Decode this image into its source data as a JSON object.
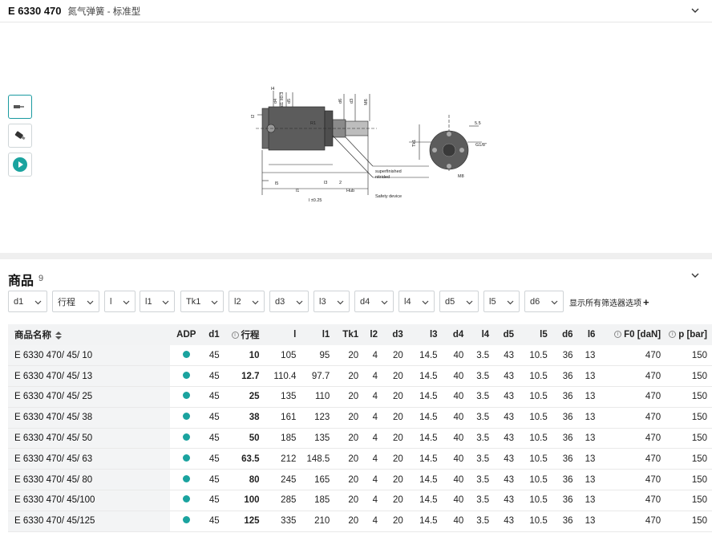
{
  "header": {
    "product_id": "E 6330 470",
    "product_name": "氮气弹簧 - 标准型"
  },
  "thumbnails": [
    {
      "name": "drawing-thumbnail",
      "active": true
    },
    {
      "name": "photo-thumbnail",
      "active": false
    },
    {
      "name": "video-thumbnail",
      "active": false
    }
  ],
  "drawing": {
    "labels": {
      "l2": "l2",
      "l4": "l4",
      "d4": "d4",
      "d1": "d1 ±0.3",
      "d5": "d5",
      "r1": "R1",
      "d6": "d6",
      "d3": "d3",
      "m6": "M6",
      "tk1": "Tk1",
      "l5": "l5",
      "l1": "l1",
      "l3": "l3",
      "two": "2",
      "hub": "Hub",
      "l": "l ±0.25",
      "superfinished": "superfinished",
      "nitrided": "nitrided",
      "safety": "Safety device",
      "dim55": "5.5",
      "g18": "G1/8\"",
      "m8": "M8"
    }
  },
  "products": {
    "title": "商品",
    "count": "9"
  },
  "filters": [
    "d1",
    "行程",
    "l",
    "l1",
    "Tk1",
    "l2",
    "d3",
    "l3",
    "d4",
    "l4",
    "d5",
    "l5",
    "d6"
  ],
  "show_all_label": "显示所有筛选器选项",
  "table": {
    "headers": {
      "name": "商品名称",
      "adp": "ADP",
      "d1": "d1",
      "stroke": "行程",
      "l": "l",
      "l1": "l1",
      "tk1": "Tk1",
      "l2": "l2",
      "d3": "d3",
      "l3": "l3",
      "d4": "d4",
      "l4": "l4",
      "d5": "d5",
      "l5": "l5",
      "d6": "d6",
      "l6": "l6",
      "f0": "F0 [daN]",
      "p": "p [bar]"
    },
    "rows": [
      {
        "name": "E 6330 470/ 45/ 10",
        "d1": "45",
        "stroke": "10",
        "l": "105",
        "l1": "95",
        "tk1": "20",
        "l2": "4",
        "d3": "20",
        "l3": "14.5",
        "d4": "40",
        "l4": "3.5",
        "d5": "43",
        "l5": "10.5",
        "d6": "36",
        "l6": "13",
        "f0": "470",
        "p": "150"
      },
      {
        "name": "E 6330 470/ 45/ 13",
        "d1": "45",
        "stroke": "12.7",
        "l": "110.4",
        "l1": "97.7",
        "tk1": "20",
        "l2": "4",
        "d3": "20",
        "l3": "14.5",
        "d4": "40",
        "l4": "3.5",
        "d5": "43",
        "l5": "10.5",
        "d6": "36",
        "l6": "13",
        "f0": "470",
        "p": "150"
      },
      {
        "name": "E 6330 470/ 45/ 25",
        "d1": "45",
        "stroke": "25",
        "l": "135",
        "l1": "110",
        "tk1": "20",
        "l2": "4",
        "d3": "20",
        "l3": "14.5",
        "d4": "40",
        "l4": "3.5",
        "d5": "43",
        "l5": "10.5",
        "d6": "36",
        "l6": "13",
        "f0": "470",
        "p": "150"
      },
      {
        "name": "E 6330 470/ 45/ 38",
        "d1": "45",
        "stroke": "38",
        "l": "161",
        "l1": "123",
        "tk1": "20",
        "l2": "4",
        "d3": "20",
        "l3": "14.5",
        "d4": "40",
        "l4": "3.5",
        "d5": "43",
        "l5": "10.5",
        "d6": "36",
        "l6": "13",
        "f0": "470",
        "p": "150"
      },
      {
        "name": "E 6330 470/ 45/ 50",
        "d1": "45",
        "stroke": "50",
        "l": "185",
        "l1": "135",
        "tk1": "20",
        "l2": "4",
        "d3": "20",
        "l3": "14.5",
        "d4": "40",
        "l4": "3.5",
        "d5": "43",
        "l5": "10.5",
        "d6": "36",
        "l6": "13",
        "f0": "470",
        "p": "150"
      },
      {
        "name": "E 6330 470/ 45/ 63",
        "d1": "45",
        "stroke": "63.5",
        "l": "212",
        "l1": "148.5",
        "tk1": "20",
        "l2": "4",
        "d3": "20",
        "l3": "14.5",
        "d4": "40",
        "l4": "3.5",
        "d5": "43",
        "l5": "10.5",
        "d6": "36",
        "l6": "13",
        "f0": "470",
        "p": "150"
      },
      {
        "name": "E 6330 470/ 45/ 80",
        "d1": "45",
        "stroke": "80",
        "l": "245",
        "l1": "165",
        "tk1": "20",
        "l2": "4",
        "d3": "20",
        "l3": "14.5",
        "d4": "40",
        "l4": "3.5",
        "d5": "43",
        "l5": "10.5",
        "d6": "36",
        "l6": "13",
        "f0": "470",
        "p": "150"
      },
      {
        "name": "E 6330 470/ 45/100",
        "d1": "45",
        "stroke": "100",
        "l": "285",
        "l1": "185",
        "tk1": "20",
        "l2": "4",
        "d3": "20",
        "l3": "14.5",
        "d4": "40",
        "l4": "3.5",
        "d5": "43",
        "l5": "10.5",
        "d6": "36",
        "l6": "13",
        "f0": "470",
        "p": "150"
      },
      {
        "name": "E 6330 470/ 45/125",
        "d1": "45",
        "stroke": "125",
        "l": "335",
        "l1": "210",
        "tk1": "20",
        "l2": "4",
        "d3": "20",
        "l3": "14.5",
        "d4": "40",
        "l4": "3.5",
        "d5": "43",
        "l5": "10.5",
        "d6": "36",
        "l6": "13",
        "f0": "470",
        "p": "150"
      }
    ]
  },
  "colors": {
    "accent": "#1aa39f",
    "header_bg": "#f2f3f4",
    "border": "#cfd3d6"
  }
}
